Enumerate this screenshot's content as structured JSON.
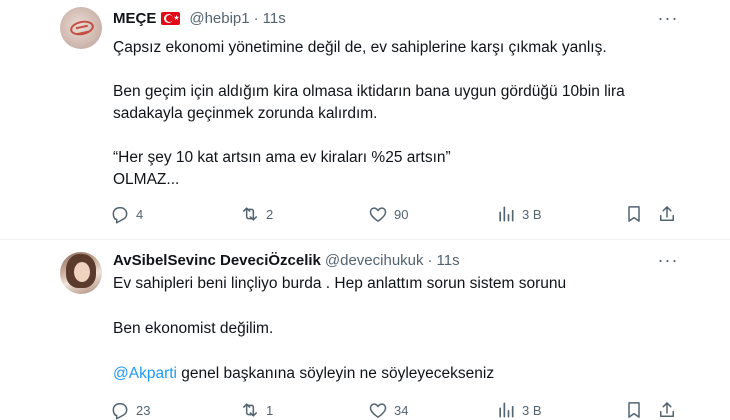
{
  "tweets": [
    {
      "author": {
        "name": "MEÇE",
        "handle": "@hebip1",
        "flag": "turkey-flag-icon"
      },
      "time": "11s",
      "lines": [
        "Çapsız ekonomi yönetimine değil de, ev sahiplerine karşı çıkmak yanlış.",
        "Ben geçim için aldığım kira olmasa iktidarın bana  uygun gördüğü 10bin lira",
        "sadakayla geçinmek zorunda kalırdım.",
        "“Her şey 10 kat artsın ama ev kiraları %25 artsın”",
        "OLMAZ..."
      ],
      "actions": {
        "replies": "4",
        "retweets": "2",
        "likes": "90",
        "views": "3 B"
      }
    },
    {
      "author": {
        "name": "AvSibelSevinc DeveciÖzcelik",
        "handle": "@devecihukuk"
      },
      "time": "11s",
      "lines": [
        "Ev sahipleri beni linçliyo burda . Hep anlattım sorun sistem sorunu",
        "Ben ekonomist değilim."
      ],
      "mention_line": {
        "mention": "@Akparti",
        "rest": " genel başkanına söyleyin ne söyleyecekseniz"
      },
      "actions": {
        "replies": "23",
        "retweets": "1",
        "likes": "34",
        "views": "3 B"
      }
    }
  ],
  "colors": {
    "text": "#0f1419",
    "secondary": "#536471",
    "link": "#1d9bf0",
    "divider": "#eff3f4"
  }
}
